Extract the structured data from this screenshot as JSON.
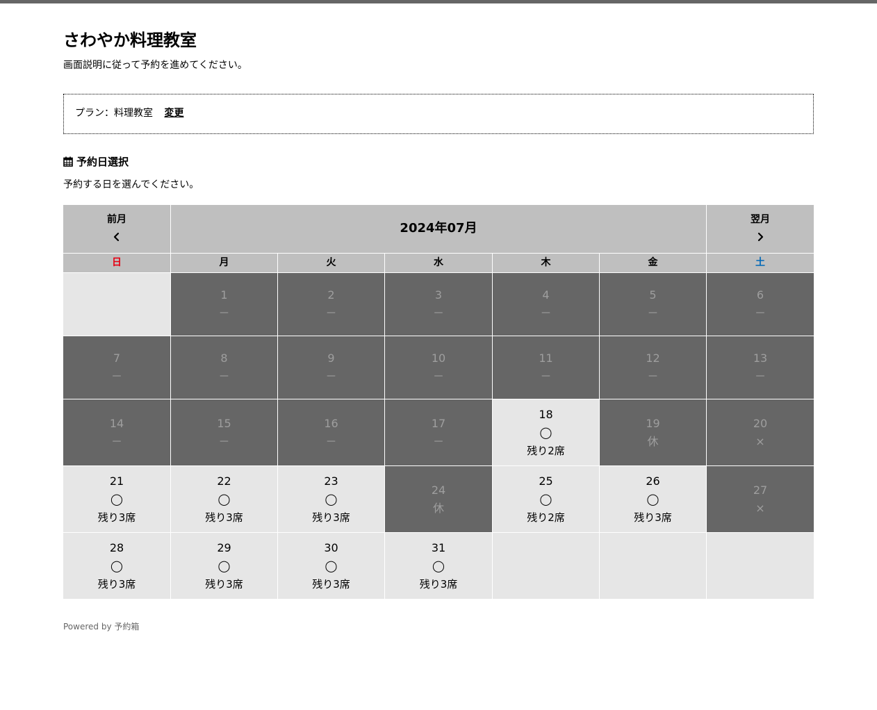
{
  "page": {
    "title": "さわやか料理教室",
    "subtitle": "画面説明に従って予約を進めてください。"
  },
  "plan": {
    "label": "プラン：料理教室",
    "change_label": "変更"
  },
  "date_section": {
    "icon": "calendar-icon",
    "title": "予約日選択",
    "description": "予約する日を選んでください。"
  },
  "calendar": {
    "prev_label": "前月",
    "next_label": "翌月",
    "month_label": "2024年07月",
    "weekdays": [
      {
        "label": "日",
        "color": "#e60012"
      },
      {
        "label": "月",
        "color": "#000000"
      },
      {
        "label": "火",
        "color": "#000000"
      },
      {
        "label": "水",
        "color": "#000000"
      },
      {
        "label": "木",
        "color": "#000000"
      },
      {
        "label": "金",
        "color": "#000000"
      },
      {
        "label": "土",
        "color": "#0068b7"
      }
    ],
    "weeks": [
      [
        {
          "blank": true
        },
        {
          "day": "1",
          "mark": "－",
          "available": false
        },
        {
          "day": "2",
          "mark": "－",
          "available": false
        },
        {
          "day": "3",
          "mark": "－",
          "available": false
        },
        {
          "day": "4",
          "mark": "－",
          "available": false
        },
        {
          "day": "5",
          "mark": "－",
          "available": false
        },
        {
          "day": "6",
          "mark": "－",
          "available": false
        }
      ],
      [
        {
          "day": "7",
          "mark": "－",
          "available": false
        },
        {
          "day": "8",
          "mark": "－",
          "available": false
        },
        {
          "day": "9",
          "mark": "－",
          "available": false
        },
        {
          "day": "10",
          "mark": "－",
          "available": false
        },
        {
          "day": "11",
          "mark": "－",
          "available": false
        },
        {
          "day": "12",
          "mark": "－",
          "available": false
        },
        {
          "day": "13",
          "mark": "－",
          "available": false
        }
      ],
      [
        {
          "day": "14",
          "mark": "－",
          "available": false
        },
        {
          "day": "15",
          "mark": "－",
          "available": false
        },
        {
          "day": "16",
          "mark": "－",
          "available": false
        },
        {
          "day": "17",
          "mark": "－",
          "available": false
        },
        {
          "day": "18",
          "mark": "◯",
          "seats": "残り2席",
          "available": true
        },
        {
          "day": "19",
          "mark": "休",
          "available": false
        },
        {
          "day": "20",
          "mark": "×",
          "available": false
        }
      ],
      [
        {
          "day": "21",
          "mark": "◯",
          "seats": "残り3席",
          "available": true
        },
        {
          "day": "22",
          "mark": "◯",
          "seats": "残り3席",
          "available": true
        },
        {
          "day": "23",
          "mark": "◯",
          "seats": "残り3席",
          "available": true
        },
        {
          "day": "24",
          "mark": "休",
          "available": false
        },
        {
          "day": "25",
          "mark": "◯",
          "seats": "残り2席",
          "available": true
        },
        {
          "day": "26",
          "mark": "◯",
          "seats": "残り3席",
          "available": true
        },
        {
          "day": "27",
          "mark": "×",
          "available": false
        }
      ],
      [
        {
          "day": "28",
          "mark": "◯",
          "seats": "残り3席",
          "available": true
        },
        {
          "day": "29",
          "mark": "◯",
          "seats": "残り3席",
          "available": true
        },
        {
          "day": "30",
          "mark": "◯",
          "seats": "残り3席",
          "available": true
        },
        {
          "day": "31",
          "mark": "◯",
          "seats": "残り3席",
          "available": true
        },
        {
          "blank": true
        },
        {
          "blank": true
        },
        {
          "blank": true
        }
      ]
    ]
  },
  "footer": {
    "text": "Powered by 予約箱"
  },
  "colors": {
    "header_bg": "#bfbfbf",
    "open_cell": "#e6e6e6",
    "closed_cell": "#666666",
    "closed_text": "#9e9e9e",
    "top_bar": "#666666"
  }
}
